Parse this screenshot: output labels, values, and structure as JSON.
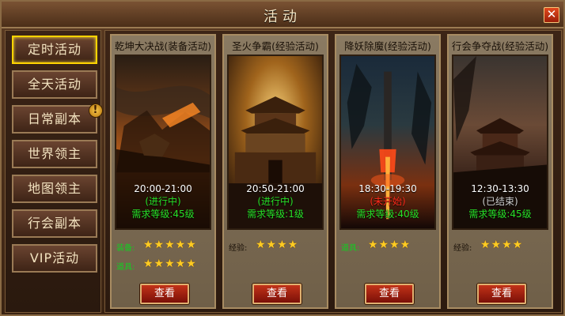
{
  "window": {
    "title": "活动",
    "close_icon": "close-icon"
  },
  "sidebar": {
    "items": [
      {
        "label": "定时活动",
        "active": true
      },
      {
        "label": "全天活动"
      },
      {
        "label": "日常副本",
        "badge": "!"
      },
      {
        "label": "世界领主"
      },
      {
        "label": "地图领主"
      },
      {
        "label": "行会副本"
      },
      {
        "label": "VIP活动"
      }
    ]
  },
  "cards": [
    {
      "title": "乾坤大决战(装备活动)",
      "time": "20:00-21:00",
      "status": "(进行中)",
      "status_color": "#28e028",
      "requirement": "需求等级:45级",
      "ratings": [
        {
          "label": "装备:",
          "stars": "★★★★★",
          "green": true
        },
        {
          "label": "道具:",
          "stars": "★★★★★",
          "green": true
        }
      ],
      "button": "查看"
    },
    {
      "title": "圣火争霸(经验活动)",
      "time": "20:50-21:00",
      "status": "(进行中)",
      "status_color": "#28e028",
      "requirement": "需求等级:1级",
      "ratings": [
        {
          "label": "经验:",
          "stars": "★★★★",
          "green": false
        }
      ],
      "button": "查看"
    },
    {
      "title": "降妖除魔(经验活动)",
      "time": "18:30-19:30",
      "status": "(未开始)",
      "status_color": "#ff2a1a",
      "requirement": "需求等级:40级",
      "ratings": [
        {
          "label": "道具:",
          "stars": "★★★★",
          "green": true
        }
      ],
      "button": "查看"
    },
    {
      "title": "行会争夺战(经验活动)",
      "time": "12:30-13:30",
      "status": "(已结束)",
      "status_color": "#cfcfcf",
      "requirement": "需求等级:45级",
      "ratings": [
        {
          "label": "经验:",
          "stars": "★★★★",
          "green": false
        }
      ],
      "button": "查看"
    }
  ]
}
